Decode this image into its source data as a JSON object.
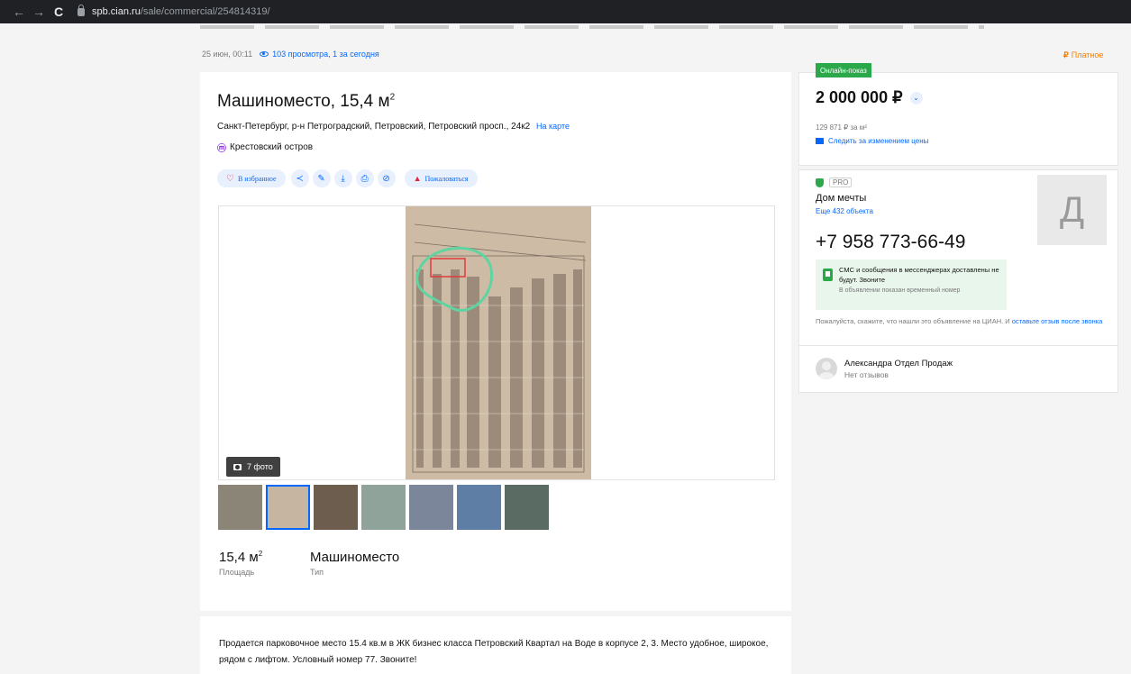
{
  "browser": {
    "back": "←",
    "forward": "→",
    "reload": "C",
    "url_host": "spb.cian.ru",
    "url_path": "/sale/commercial/254814319/"
  },
  "meta": {
    "date": "25 июн, 00:11",
    "views": "103 просмотра, 1 за сегодня",
    "paid_symbol": "₽",
    "paid": "Платное"
  },
  "listing": {
    "title": "Машиноместо, 15,4 м",
    "title_sup": "2",
    "address": "Санкт-Петербург, р-н Петроградский, Петровский, Петровский просп., 24к2",
    "map_link": "На карте",
    "metro_symbol": "ⓜ",
    "metro": "Крестовский остров",
    "actions": {
      "favorite": "В избранное",
      "complain": "Пожаловаться"
    },
    "photo_count": "7 фото",
    "thumbs": [
      {
        "color": "#8a8576"
      },
      {
        "color": "#c6b5a0"
      },
      {
        "color": "#6d5d4f"
      },
      {
        "color": "#8fa39a"
      },
      {
        "color": "#7c869a"
      },
      {
        "color": "#5f7ea6"
      },
      {
        "color": "#5a6b63"
      }
    ],
    "specs": [
      {
        "value": "15,4 м",
        "sup": "2",
        "label": "Площадь"
      },
      {
        "value": "Машиноместо",
        "sup": "",
        "label": "Тип"
      }
    ],
    "description": "Продается парковочное место 15.4 кв.м в ЖК бизнес класса Петровский Квартал на Воде в корпусе 2, 3. Место удобное, широкое, рядом с лифтом. Условный номер 77. Звоните!"
  },
  "price": {
    "badge": "Онлайн-показ",
    "value": "2 000 000 ₽",
    "per_meter": "129 871 ₽ за м²",
    "track": "Следить за изменением цены"
  },
  "agent": {
    "pro": "PRO",
    "agency": "Дом мечты",
    "more_objects": "Еще 432 объекта",
    "avatar_letter": "Д",
    "phone": "+7 958 773-66-49",
    "notice_title": "СМС и сообщения в мессенджерах доставлены не будут. Звоните",
    "notice_sub": "В объявлении показан временный номер",
    "ask_text": "Пожалуйста, скажите, что нашли это объявление на ЦИАН. И",
    "ask_link": "оставьте отзыв после звонка",
    "person_name": "Александра Отдел Продаж",
    "reviews": "Нет отзывов"
  },
  "colors": {
    "accent": "#0468ff",
    "green": "#2ba84a",
    "danger": "#e3263d",
    "paid": "#f57c00"
  }
}
